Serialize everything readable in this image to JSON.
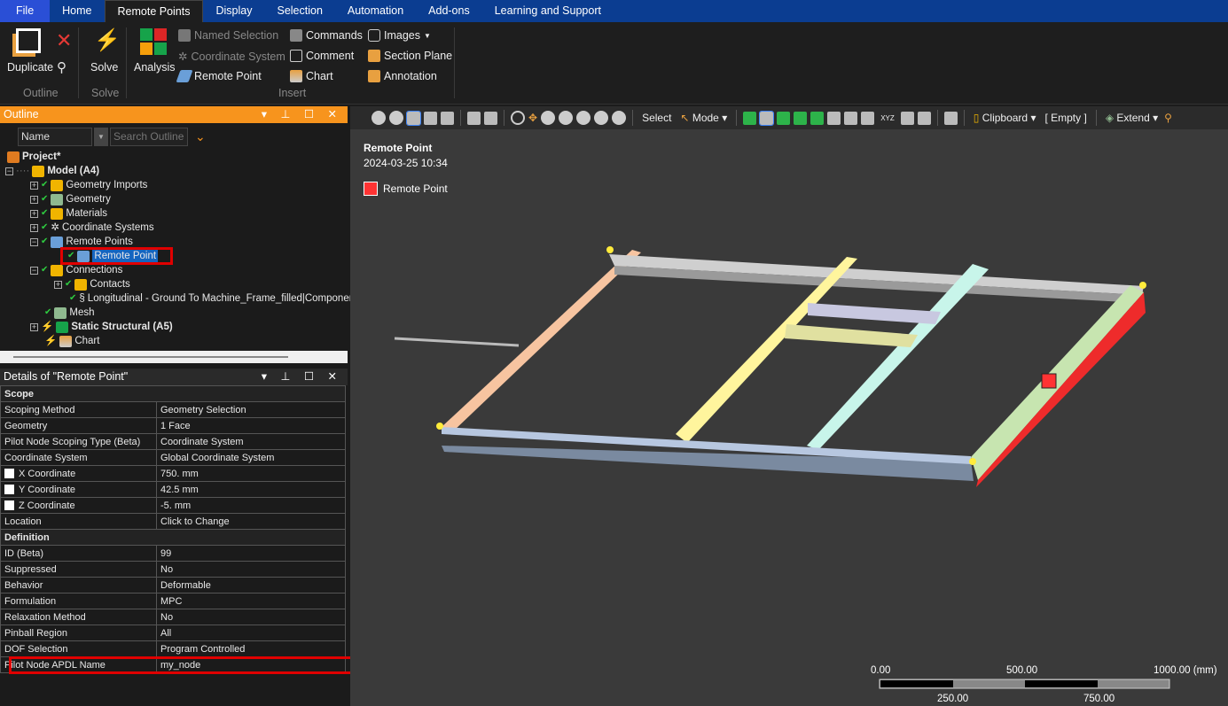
{
  "tabs": [
    "File",
    "Home",
    "Remote Points",
    "Display",
    "Selection",
    "Automation",
    "Add-ons",
    "Learning and Support"
  ],
  "ribbon": {
    "duplicate": "Duplicate",
    "solve": "Solve",
    "analysis": "Analysis",
    "named_selection": "Named Selection",
    "coordinate_system": "Coordinate System",
    "remote_point": "Remote Point",
    "commands": "Commands",
    "comment": "Comment",
    "chart": "Chart",
    "images": "Images",
    "section_plane": "Section Plane",
    "annotation": "Annotation",
    "groups": {
      "outline": "Outline",
      "solve": "Solve",
      "insert": "Insert"
    }
  },
  "outline": {
    "title": "Outline",
    "filter": "Name",
    "search_placeholder": "Search Outline",
    "tree": [
      "Project*",
      "Model (A4)",
      "Geometry Imports",
      "Geometry",
      "Materials",
      "Coordinate Systems",
      "Remote Points",
      "Remote Point",
      "Connections",
      "Contacts",
      "Longitudinal - Ground To Machine_Frame_filled|Component",
      "Mesh",
      "Static Structural (A5)",
      "Chart"
    ]
  },
  "details": {
    "title": "Details of \"Remote Point\"",
    "sections": [
      {
        "name": "Scope",
        "rows": [
          [
            "Scoping Method",
            "Geometry Selection"
          ],
          [
            "Geometry",
            "1 Face"
          ],
          [
            "Pilot Node Scoping Type (Beta)",
            "Coordinate System"
          ],
          [
            "Coordinate System",
            "Global Coordinate System"
          ],
          [
            "X Coordinate",
            "750. mm"
          ],
          [
            "Y Coordinate",
            "42.5 mm"
          ],
          [
            "Z Coordinate",
            "-5. mm"
          ],
          [
            "Location",
            "Click to Change"
          ]
        ]
      },
      {
        "name": "Definition",
        "rows": [
          [
            "ID (Beta)",
            "99"
          ],
          [
            "Suppressed",
            "No"
          ],
          [
            "Behavior",
            "Deformable"
          ],
          [
            "Formulation",
            "MPC"
          ],
          [
            "Relaxation Method",
            "No"
          ],
          [
            "Pinball Region",
            "All"
          ],
          [
            "DOF Selection",
            "Program Controlled"
          ],
          [
            "Pilot Node APDL Name",
            "my_node"
          ]
        ]
      }
    ]
  },
  "toolbar": {
    "select": "Select",
    "mode": "Mode",
    "clipboard": "Clipboard",
    "empty": "[ Empty ]",
    "extend": "Extend"
  },
  "viewport": {
    "title": "Remote Point",
    "date": "2024-03-25 10:34",
    "legend": "Remote Point",
    "legend_color": "#ff3333",
    "scale": {
      "labels_top": [
        "0.00",
        "500.00",
        "1000.00 (mm)"
      ],
      "labels_bottom": [
        "250.00",
        "750.00"
      ]
    }
  },
  "colors": {
    "accent": "#f7941d",
    "tab_bar": "#0b3d91",
    "highlight": "#e00000"
  }
}
